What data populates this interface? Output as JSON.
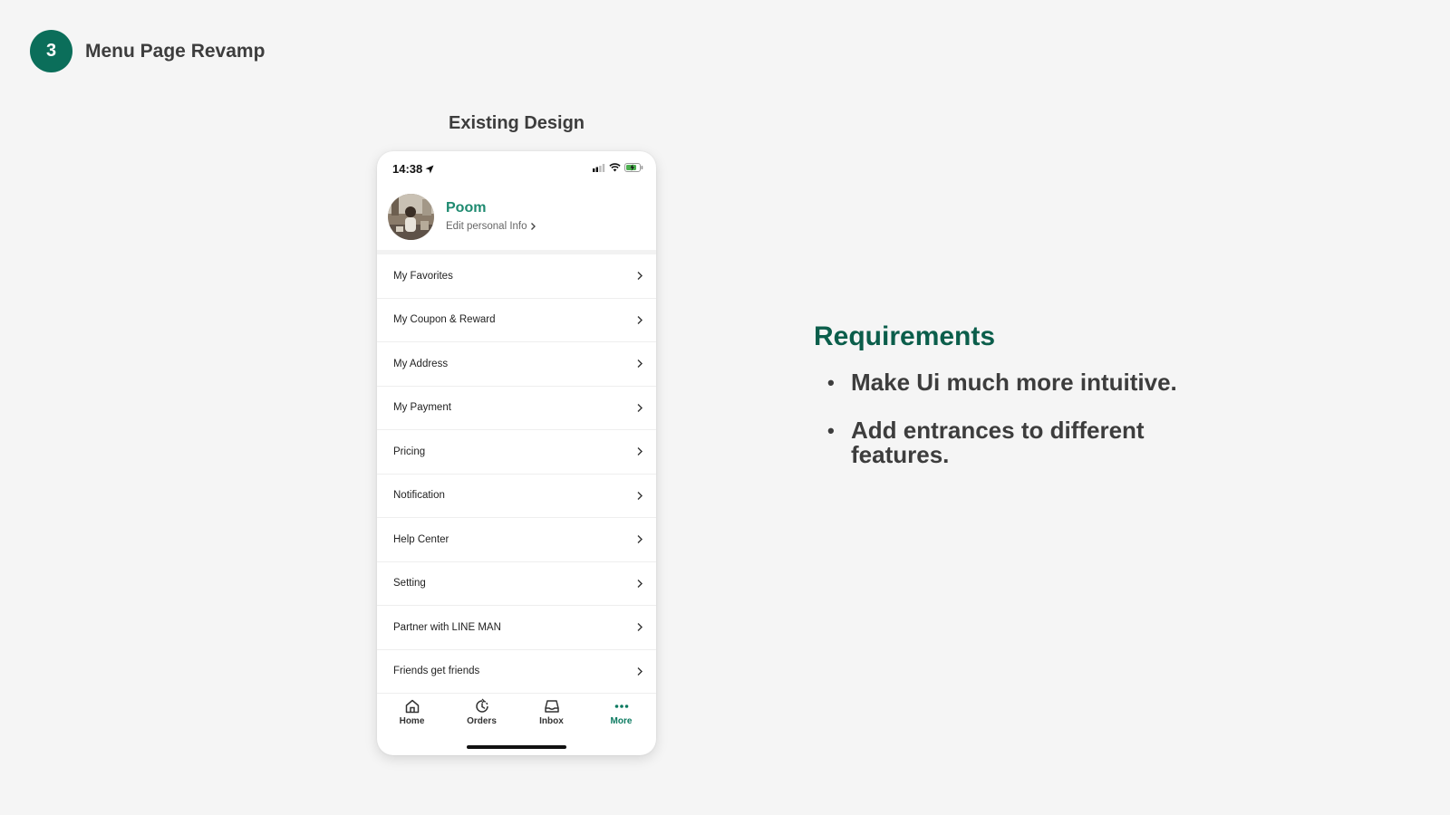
{
  "slide": {
    "step_number": "3",
    "title": "Menu Page Revamp",
    "existing_label": "Existing Design"
  },
  "phone": {
    "status_time": "14:38",
    "profile": {
      "name": "Poom",
      "edit_label": "Edit personal Info"
    },
    "menu_items": [
      {
        "label": "My Favorites"
      },
      {
        "label": "My Coupon & Reward"
      },
      {
        "label": "My Address"
      },
      {
        "label": "My Payment"
      },
      {
        "label": "Pricing"
      },
      {
        "label": "Notification"
      },
      {
        "label": "Help Center"
      },
      {
        "label": "Setting"
      },
      {
        "label": "Partner with LINE MAN"
      },
      {
        "label": "Friends get friends"
      }
    ],
    "tabs": [
      {
        "label": "Home",
        "icon": "home-icon"
      },
      {
        "label": "Orders",
        "icon": "orders-icon"
      },
      {
        "label": "Inbox",
        "icon": "inbox-icon"
      },
      {
        "label": "More",
        "icon": "more-icon",
        "active": true
      }
    ]
  },
  "requirements": {
    "title": "Requirements",
    "items": [
      "Make Ui much more intuitive.",
      "Add entrances to different features."
    ]
  },
  "colors": {
    "brand_green": "#0b6e5a",
    "name_green": "#1e8a70",
    "heading_green": "#0b5e4b"
  }
}
